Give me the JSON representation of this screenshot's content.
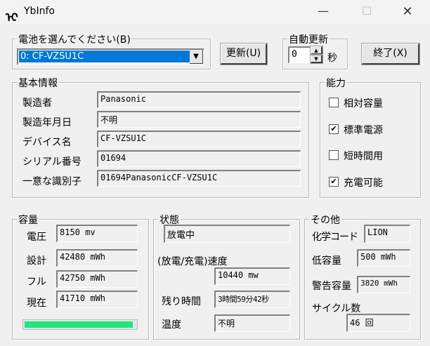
{
  "window": {
    "title": "YbInfo",
    "icon": "app-logo-icon"
  },
  "battery_select": {
    "label": "電池を選んでください(B)",
    "selected": "0: CF-VZSU1C"
  },
  "refresh_button": "更新(U)",
  "auto_refresh": {
    "label": "自動更新",
    "value": "0",
    "unit": "秒"
  },
  "exit_button": "終了(X)",
  "basic_info": {
    "label": "基本情報",
    "rows": [
      {
        "label": "製造者",
        "value": "Panasonic"
      },
      {
        "label": "製造年月日",
        "value": "不明"
      },
      {
        "label": "デバイス名",
        "value": "CF-VZSU1C"
      },
      {
        "label": "シリアル番号",
        "value": "01694"
      },
      {
        "label": "一意な識別子",
        "value": "01694PanasonicCF-VZSU1C"
      }
    ]
  },
  "capabilities": {
    "label": "能力",
    "items": [
      {
        "label": "相対容量",
        "checked": false
      },
      {
        "label": "標準電源",
        "checked": true
      },
      {
        "label": "短時間用",
        "checked": false
      },
      {
        "label": "充電可能",
        "checked": true
      }
    ]
  },
  "capacity": {
    "label": "容量",
    "rows": [
      {
        "label": "電圧",
        "value": "8150 mv"
      },
      {
        "label": "設計",
        "value": "42480 mWh"
      },
      {
        "label": "フル",
        "value": "42750 mWh"
      },
      {
        "label": "現在",
        "value": "41710 mWh"
      }
    ],
    "progress_percent": 97.6,
    "progress_color": "#1ee67a"
  },
  "status": {
    "label": "状態",
    "state": "放電中",
    "rate_label": "(放電/充電)速度",
    "rate": "10440 mw",
    "remaining_label": "残り時間",
    "remaining": "3時間59分42秒",
    "temp_label": "温度",
    "temp": "不明"
  },
  "other": {
    "label": "その他",
    "chem_label": "化学コード",
    "chem": "LION",
    "low_label": "低容量",
    "low": "500 mWh",
    "warn_label": "警告容量",
    "warn": "3820 mWh",
    "cycle_label": "サイクル数",
    "cycle": "46 回"
  }
}
